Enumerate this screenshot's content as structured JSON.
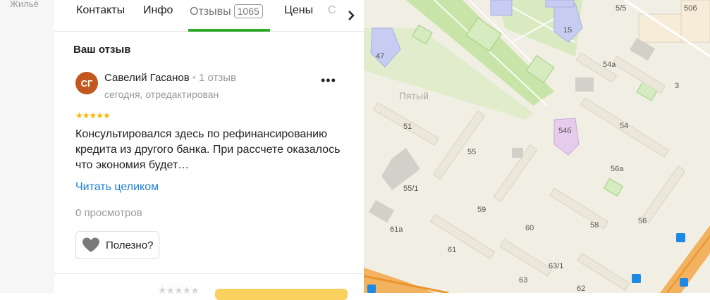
{
  "left_strip": {
    "label": "Жильё"
  },
  "tabs": [
    {
      "label": "Контакты"
    },
    {
      "label": "Инфо"
    },
    {
      "label": "Отзывы",
      "badge": "1065",
      "active": true
    },
    {
      "label": "Цены"
    },
    {
      "label": "С"
    }
  ],
  "section_title": "Ваш отзыв",
  "review": {
    "avatar_initials": "СГ",
    "avatar_color": "#c2581e",
    "author": "Савелий Гасанов",
    "author_reviews": "1 отзыв",
    "date": "сегодня, отредактирован",
    "rating": 5,
    "stars": "★★★★★",
    "text": "Консультировался здесь по рефинансированию кредита из другого банка. При рассчете оказалось что экономия будет…",
    "read_more": "Читать целиком",
    "views": "0 просмотров",
    "useful_label": "Полезно?"
  },
  "bottom": {
    "stars": "★★★★★"
  },
  "map": {
    "labels": {
      "l47": "47",
      "l15": "15",
      "l55": "55",
      "l51": "51",
      "l551": "55/1",
      "l59": "59",
      "l60": "60",
      "l61": "61",
      "l61a": "61а",
      "l631": "63/1",
      "l62": "62",
      "l54a": "54а",
      "l54b": "54б",
      "l54": "54",
      "l56a": "56а",
      "l56": "56",
      "l58": "58",
      "l55b": "5/5",
      "l50b": "50б",
      "l3": "3",
      "l63": "63",
      "pyatyi": "Пятый"
    }
  },
  "colors": {
    "accent_green": "#2fa82a",
    "link_blue": "#1c7fd6",
    "star_yellow": "#fbb700"
  }
}
